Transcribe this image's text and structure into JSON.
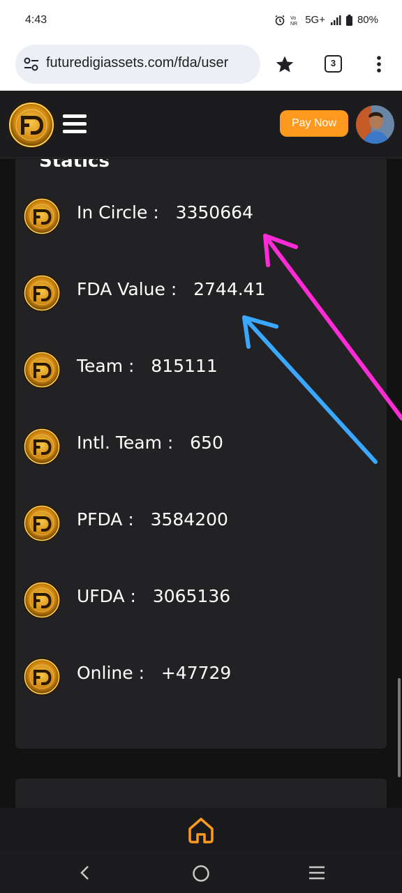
{
  "status_bar": {
    "time": "4:43",
    "network": "5G+",
    "battery": "80%",
    "icons": [
      "alarm-icon",
      "volte-icon",
      "signal-icon",
      "battery-icon"
    ]
  },
  "browser": {
    "url": "futuredigiassets.com/fda/user",
    "tab_count": "3",
    "icons": [
      "site-settings-icon",
      "bookmark-star-icon",
      "tab-switcher-icon",
      "more-vert-icon"
    ]
  },
  "header": {
    "logo_text": "FD",
    "pay_button": "Pay Now",
    "colors": {
      "accent": "#ff9a1f",
      "bg": "#1c1c1e",
      "card": "#222224"
    }
  },
  "stats": {
    "heading": "Statics",
    "items": [
      {
        "label": "In Circle :",
        "value": "3350664"
      },
      {
        "label": "FDA Value :",
        "value": "2744.41"
      },
      {
        "label": "Team :",
        "value": "815111"
      },
      {
        "label": "Intl. Team :",
        "value": "650"
      },
      {
        "label": "PFDA :",
        "value": "3584200"
      },
      {
        "label": "UFDA :",
        "value": "3065136"
      },
      {
        "label": "Online :",
        "value": "+47729"
      }
    ]
  },
  "annotations": {
    "arrow_colors": [
      "#ff2bd6",
      "#3aa8ff"
    ]
  },
  "app_nav": {
    "icons": [
      "home-icon"
    ],
    "accent": "#ff9a1f"
  },
  "system_nav": {
    "icons": [
      "back-icon",
      "home-circle-icon",
      "recents-icon"
    ]
  }
}
